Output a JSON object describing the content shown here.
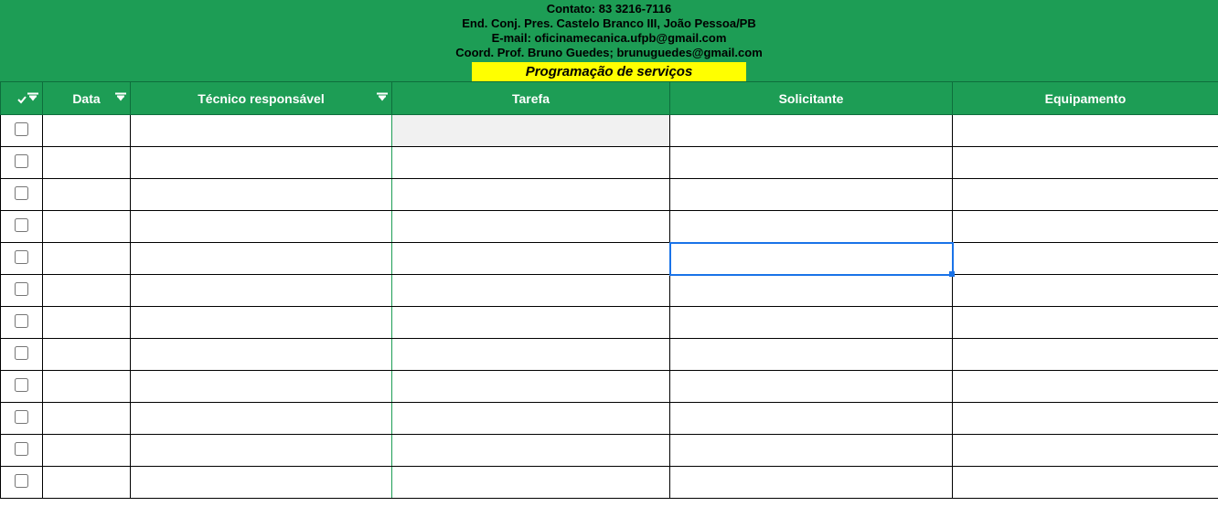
{
  "header": {
    "line1": "Contato: 83 3216-7116",
    "line2": "End. Conj. Pres. Castelo Branco III, João Pessoa/PB",
    "line3": "E-mail: oficinamecanica.ufpb@gmail.com",
    "line4": "Coord. Prof. Bruno Guedes; brunuguedes@gmail.com",
    "title": "Programação  de serviços"
  },
  "columns": {
    "check": "✓",
    "data": "Data",
    "tecnico": "Técnico responsável",
    "tarefa": "Tarefa",
    "solicitante": "Solicitante",
    "equipamento": "Equipamento"
  },
  "rows": [
    {
      "checked": false,
      "data": "",
      "tecnico": "",
      "tarefa": "",
      "solicitante": "",
      "equipamento": ""
    },
    {
      "checked": false,
      "data": "",
      "tecnico": "",
      "tarefa": "",
      "solicitante": "",
      "equipamento": ""
    },
    {
      "checked": false,
      "data": "",
      "tecnico": "",
      "tarefa": "",
      "solicitante": "",
      "equipamento": ""
    },
    {
      "checked": false,
      "data": "",
      "tecnico": "",
      "tarefa": "",
      "solicitante": "",
      "equipamento": ""
    },
    {
      "checked": false,
      "data": "",
      "tecnico": "",
      "tarefa": "",
      "solicitante": "",
      "equipamento": ""
    },
    {
      "checked": false,
      "data": "",
      "tecnico": "",
      "tarefa": "",
      "solicitante": "",
      "equipamento": ""
    },
    {
      "checked": false,
      "data": "",
      "tecnico": "",
      "tarefa": "",
      "solicitante": "",
      "equipamento": ""
    },
    {
      "checked": false,
      "data": "",
      "tecnico": "",
      "tarefa": "",
      "solicitante": "",
      "equipamento": ""
    },
    {
      "checked": false,
      "data": "",
      "tecnico": "",
      "tarefa": "",
      "solicitante": "",
      "equipamento": ""
    },
    {
      "checked": false,
      "data": "",
      "tecnico": "",
      "tarefa": "",
      "solicitante": "",
      "equipamento": ""
    },
    {
      "checked": false,
      "data": "",
      "tecnico": "",
      "tarefa": "",
      "solicitante": "",
      "equipamento": ""
    },
    {
      "checked": false,
      "data": "",
      "tecnico": "",
      "tarefa": "",
      "solicitante": "",
      "equipamento": ""
    }
  ],
  "selected_cell": {
    "row": 4,
    "col": "solicitante"
  }
}
